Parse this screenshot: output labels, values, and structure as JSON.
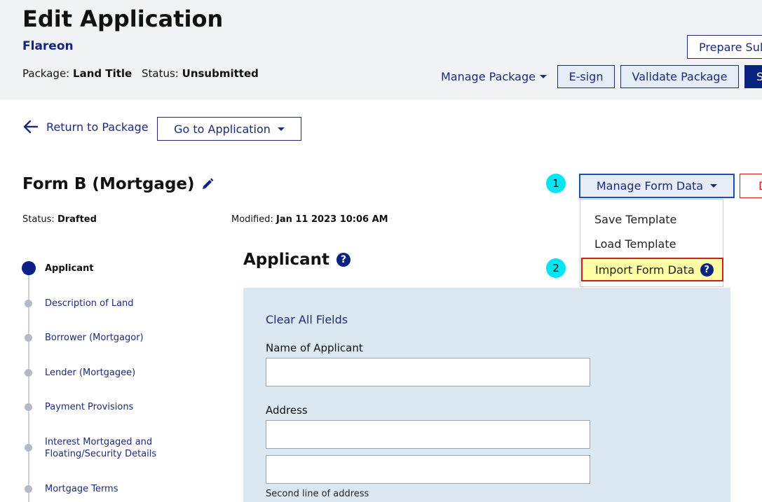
{
  "header": {
    "title": "Edit Application",
    "subtitle": "Flareon",
    "package_label": "Package:",
    "package_value": "Land Title",
    "status_label": "Status:",
    "status_value": "Unsubmitted",
    "prepare_button": "Prepare Sul",
    "manage_package": "Manage Package",
    "esign_button": "E-sign",
    "validate_button": "Validate Package",
    "submit_button": "S"
  },
  "nav": {
    "return_label": "Return to Package",
    "goto_label": "Go to Application"
  },
  "form": {
    "title": "Form B (Mortgage)",
    "status_label": "Status:",
    "status_value": "Drafted",
    "modified_label": "Modified:",
    "modified_value": "Jan 11 2023 10:06 AM",
    "manage_form_data": "Manage Form Data",
    "delete_button_partial": "D"
  },
  "annotations": {
    "badge1": "1",
    "badge2": "2"
  },
  "menu": {
    "items": [
      {
        "label": "Save Template"
      },
      {
        "label": "Load Template"
      },
      {
        "label": "Import Form Data"
      }
    ]
  },
  "steps": [
    {
      "label": "Applicant",
      "active": true
    },
    {
      "label": "Description of Land"
    },
    {
      "label": "Borrower (Mortgagor)"
    },
    {
      "label": "Lender (Mortgagee)"
    },
    {
      "label": "Payment Provisions"
    },
    {
      "label": "Interest Mortgaged and Floating/Security Details"
    },
    {
      "label": "Mortgage Terms"
    }
  ],
  "section": {
    "title": "Applicant",
    "clear_link": "Clear All Fields",
    "name_label": "Name of Applicant",
    "name_value": "",
    "address_label": "Address",
    "address1_value": "",
    "address2_value": "",
    "address_hint": "Second line of address"
  },
  "colors": {
    "brand": "#0b2380",
    "link": "#1c2a7a",
    "badge": "#00e5f2",
    "highlight_fill": "#ffffa3",
    "highlight_border": "#d41b1b",
    "panel": "#dbe8f2",
    "header_bg": "#f1f2f5"
  }
}
